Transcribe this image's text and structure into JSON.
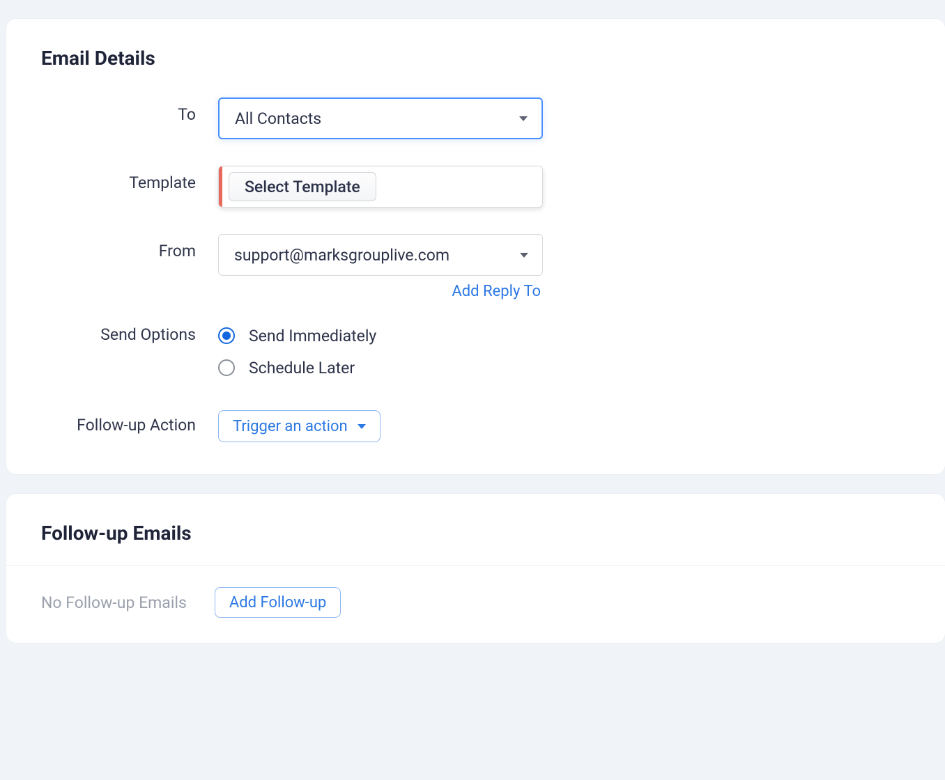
{
  "emailDetails": {
    "title": "Email Details",
    "labels": {
      "to": "To",
      "template": "Template",
      "from": "From",
      "sendOptions": "Send Options",
      "followUpAction": "Follow-up Action"
    },
    "to": {
      "selected": "All Contacts"
    },
    "template": {
      "button": "Select Template"
    },
    "from": {
      "selected": "support@marksgrouplive.com",
      "addReplyTo": "Add Reply To"
    },
    "sendOptions": {
      "options": [
        {
          "label": "Send Immediately",
          "checked": true
        },
        {
          "label": "Schedule Later",
          "checked": false
        }
      ]
    },
    "followUpAction": {
      "button": "Trigger an action"
    }
  },
  "followUpEmails": {
    "title": "Follow-up Emails",
    "empty": "No Follow-up Emails",
    "addButton": "Add Follow-up"
  }
}
